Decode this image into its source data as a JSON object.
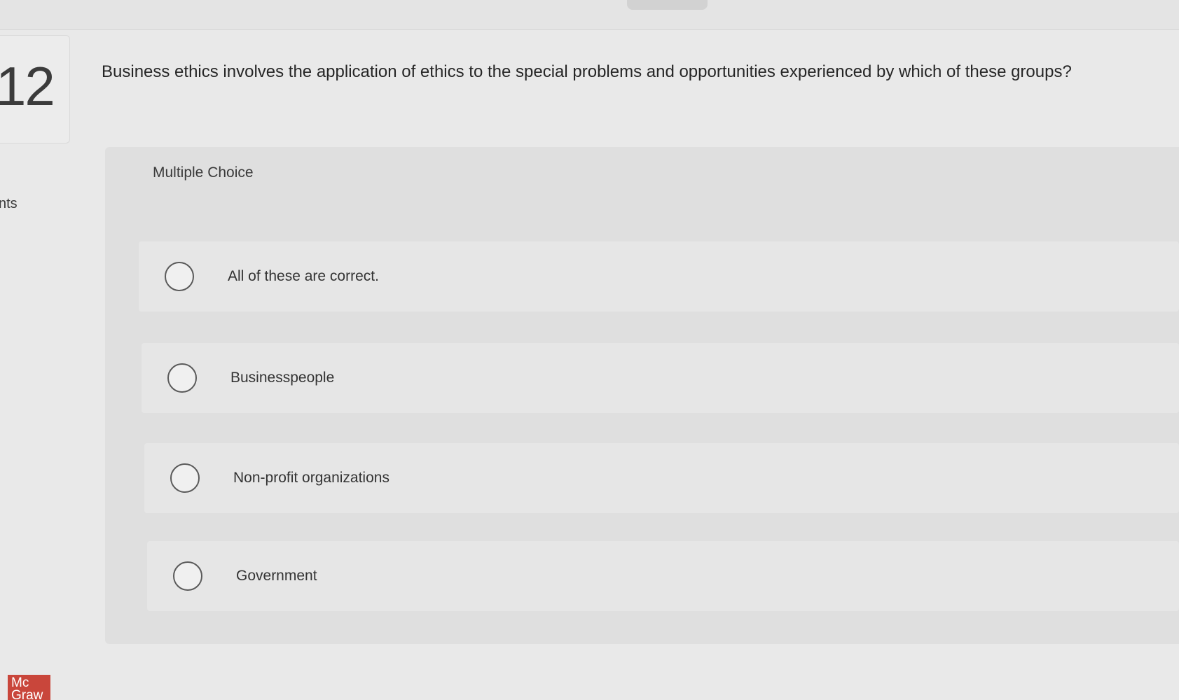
{
  "question": {
    "number": "12",
    "points_label": "nts",
    "text": "Business ethics involves the application of ethics to the special problems and opportunities experienced by which of these groups?"
  },
  "answer_section": {
    "type_label": "Multiple Choice",
    "options": [
      {
        "label": "All of these are correct."
      },
      {
        "label": "Businesspeople"
      },
      {
        "label": "Non-profit organizations"
      },
      {
        "label": "Government"
      }
    ]
  },
  "branding": {
    "logo_line1": "Mc",
    "logo_line2": "Graw"
  },
  "colors": {
    "background": "#e9e9e9",
    "panel": "#dfdfdf",
    "logo": "#c9463b"
  }
}
